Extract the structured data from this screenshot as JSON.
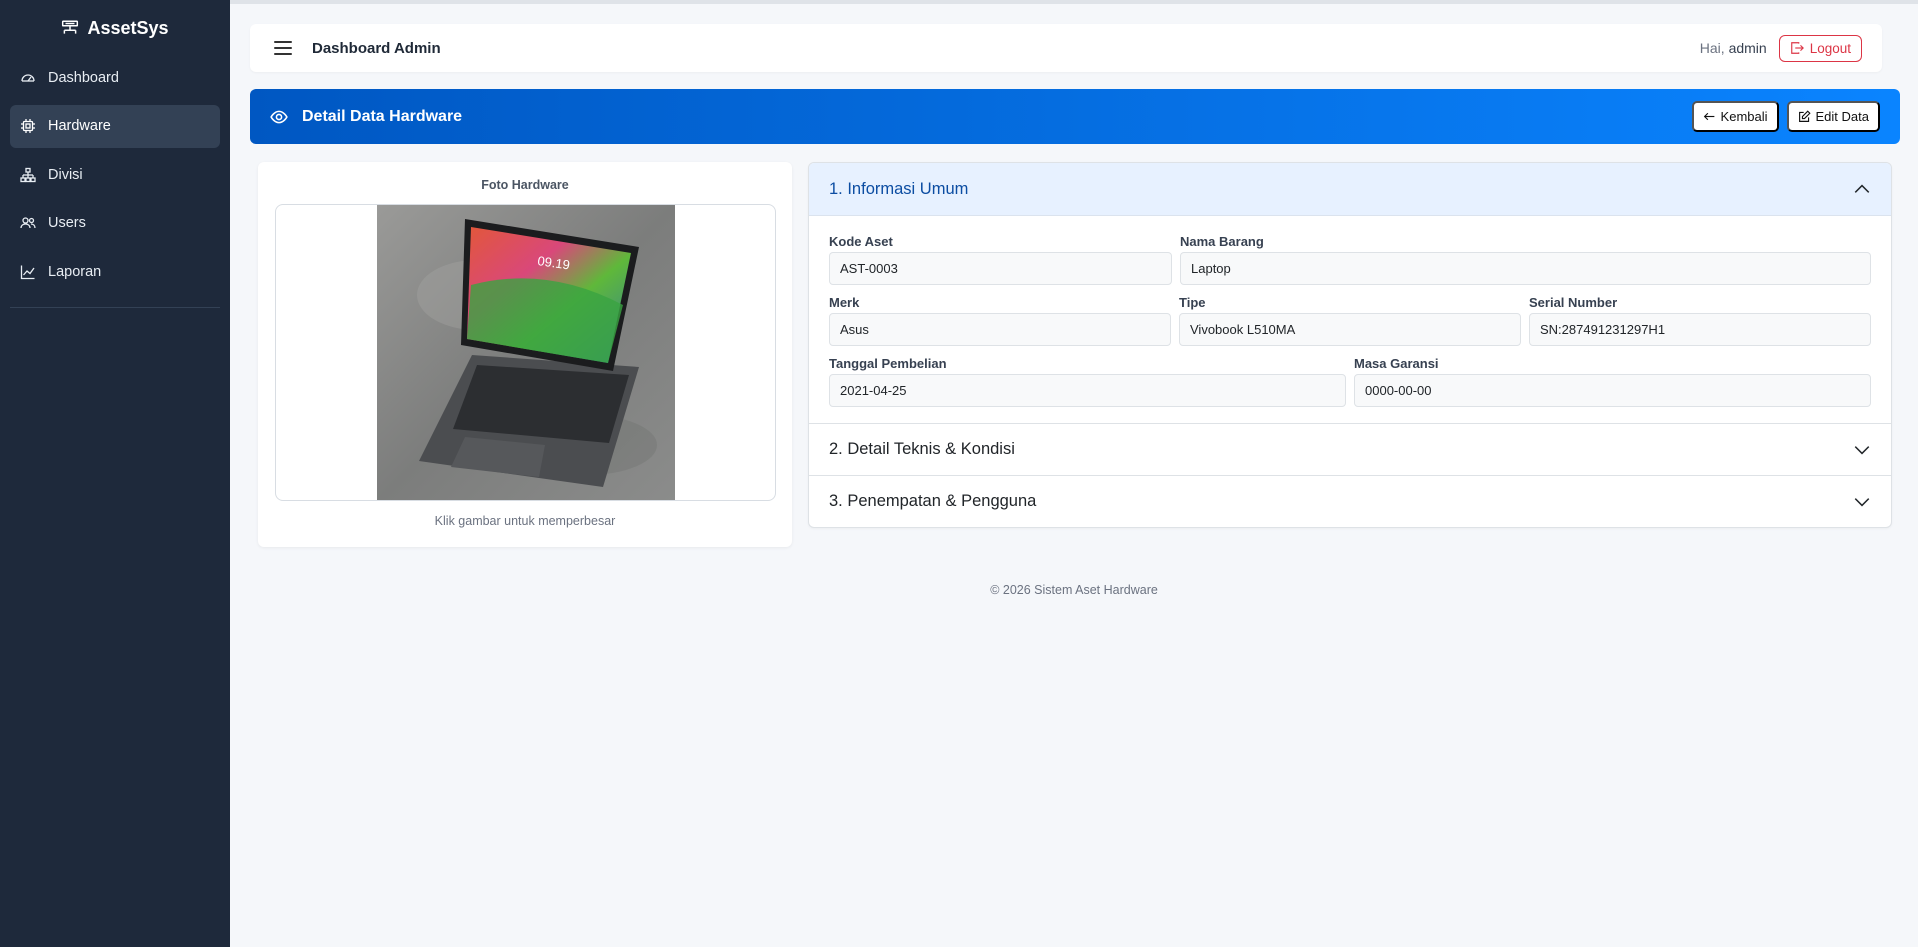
{
  "brand": {
    "name": "AssetSys",
    "icon": "server-icon"
  },
  "sidebar": {
    "items": [
      {
        "label": "Dashboard",
        "icon": "speedometer-icon",
        "active": false
      },
      {
        "label": "Hardware",
        "icon": "cpu-icon",
        "active": true
      },
      {
        "label": "Divisi",
        "icon": "diagram-icon",
        "active": false
      },
      {
        "label": "Users",
        "icon": "people-icon",
        "active": false
      },
      {
        "label": "Laporan",
        "icon": "graph-icon",
        "active": false
      }
    ]
  },
  "navbar": {
    "title": "Dashboard Admin",
    "greeting_prefix": "Hai,",
    "username": "admin",
    "logout_label": "Logout"
  },
  "header": {
    "title": "Detail Data Hardware",
    "back_label": "Kembali",
    "edit_label": "Edit Data"
  },
  "photo": {
    "label": "Foto Hardware",
    "hint": "Klik gambar untuk memperbesar",
    "screen_time": "09.19"
  },
  "sections": [
    {
      "title": "1. Informasi Umum",
      "expanded": true
    },
    {
      "title": "2. Detail Teknis & Kondisi",
      "expanded": false
    },
    {
      "title": "3. Penempatan & Pengguna",
      "expanded": false
    }
  ],
  "fields": {
    "kode_aset": {
      "label": "Kode Aset",
      "value": "AST-0003"
    },
    "nama_barang": {
      "label": "Nama Barang",
      "value": "Laptop"
    },
    "merk": {
      "label": "Merk",
      "value": "Asus"
    },
    "tipe": {
      "label": "Tipe",
      "value": "Vivobook L510MA"
    },
    "serial": {
      "label": "Serial Number",
      "value": "SN:287491231297H1"
    },
    "tanggal": {
      "label": "Tanggal Pembelian",
      "value": "2021-04-25"
    },
    "garansi": {
      "label": "Masa Garansi",
      "value": "0000-00-00"
    }
  },
  "footer": "© 2026 Sistem Aset Hardware",
  "colors": {
    "sidebar": "#1e293b",
    "header_start": "#0057c2",
    "header_end": "#0a84ff",
    "danger": "#dc3545"
  }
}
